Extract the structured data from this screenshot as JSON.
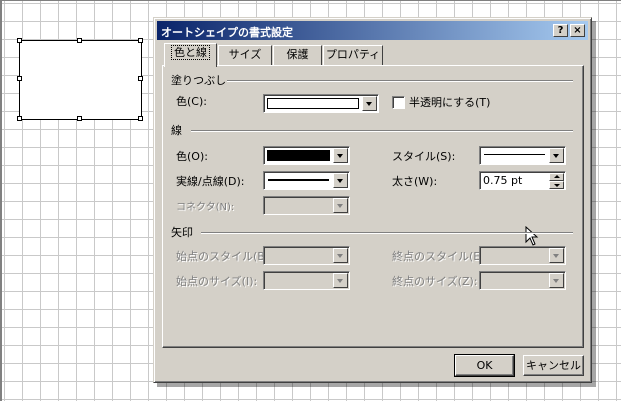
{
  "dialog": {
    "title": "オートシェイプの書式設定",
    "help_label": "?",
    "close_label": "×"
  },
  "tabs": [
    {
      "label": "色と線",
      "active": true
    },
    {
      "label": "サイズ",
      "active": false
    },
    {
      "label": "保護",
      "active": false
    },
    {
      "label": "プロパティ",
      "active": false
    }
  ],
  "fill": {
    "heading": "塗りつぶし",
    "color_label": "色(C):",
    "color_value": "#ffffff",
    "semi_transparent_label": "半透明にする(T)",
    "semi_transparent_checked": false
  },
  "line": {
    "heading": "線",
    "color_label": "色(O):",
    "color_value": "#000000",
    "style_label": "スタイル(S):",
    "dash_label": "実線/点線(D):",
    "weight_label": "太さ(W):",
    "weight_value": "0.75 pt",
    "connector_label": "コネクタ(N):"
  },
  "arrows": {
    "heading": "矢印",
    "begin_style_label": "始点のスタイル(B):",
    "end_style_label": "終点のスタイル(E):",
    "begin_size_label": "始点のサイズ(I):",
    "end_size_label": "終点のサイズ(Z):"
  },
  "buttons": {
    "ok_label": "OK",
    "cancel_label": "キャンセル"
  },
  "colors": {
    "title_gradient_start": "#0a246a",
    "title_gradient_end": "#a6caf0",
    "dialog_face": "#d4d0c8"
  }
}
